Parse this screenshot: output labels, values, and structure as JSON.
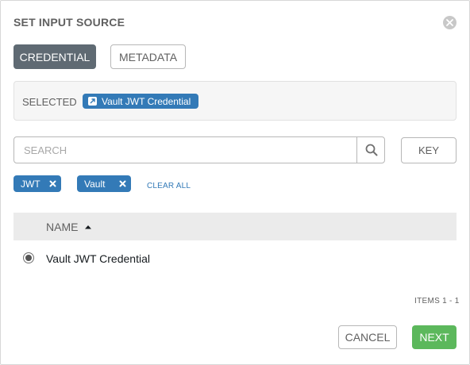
{
  "dialog": {
    "title": "SET INPUT SOURCE"
  },
  "tabs": {
    "active": "CREDENTIAL",
    "inactive": "METADATA"
  },
  "selected": {
    "label": "SELECTED",
    "chip": "Vault JWT Credential"
  },
  "search": {
    "placeholder": "SEARCH",
    "key_label": "KEY"
  },
  "filter_tags": [
    {
      "label": "JWT"
    },
    {
      "label": "Vault"
    }
  ],
  "clear_all_label": "CLEAR ALL",
  "table": {
    "column_name": "NAME",
    "sort": "ascending",
    "rows": [
      {
        "name": "Vault JWT Credential",
        "selected": true
      }
    ]
  },
  "pagination": {
    "label": "ITEMS",
    "range": "1 - 1"
  },
  "footer": {
    "cancel_label": "CANCEL",
    "next_label": "NEXT"
  },
  "colors": {
    "accent_blue": "#337ab7",
    "success_green": "#5cb85c",
    "active_tab_gray": "#5f6a73"
  }
}
